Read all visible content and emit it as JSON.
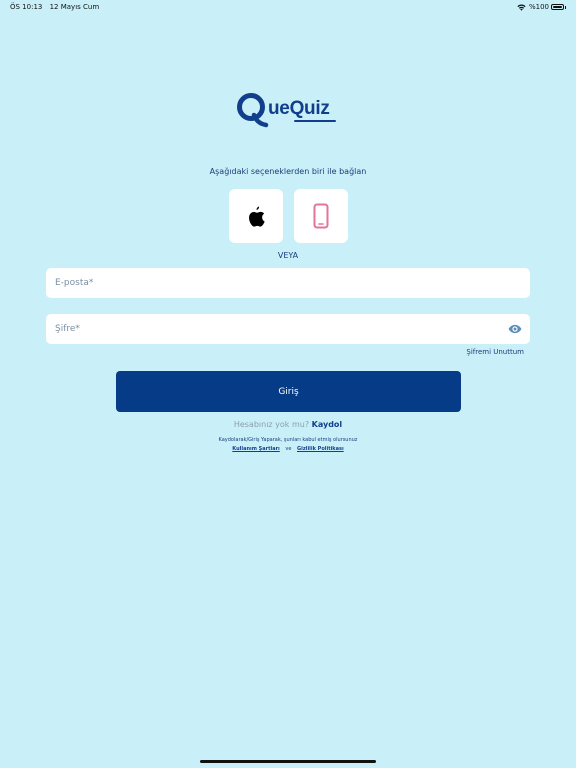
{
  "status_bar": {
    "time": "ÖS 10:13",
    "date": "12 Mayıs Cum",
    "battery": "%100"
  },
  "logo": {
    "text": "ueQuiz",
    "color": "#123f8c"
  },
  "connect": {
    "label": "Aşağıdaki seçeneklerden biri ile bağlan"
  },
  "social": {
    "apple_icon": "apple-icon",
    "phone_icon": "phone-icon",
    "phone_color": "#e0749a"
  },
  "or_label": "VEYA",
  "form": {
    "email_value": "",
    "email_placeholder": "E-posta*",
    "password_value": "",
    "password_placeholder": "Şifre*",
    "eye_icon": "eye-icon",
    "forgot_label": "Şifremi Unuttum",
    "login_label": "Giriş"
  },
  "signup": {
    "question": "Hesabınız yok mu?",
    "link": "Kaydol"
  },
  "terms": {
    "text": "Kaydolarak/Giriş Yaparak, şunları kabul etmiş olursunuz",
    "terms_link": "Kullanım Şartları",
    "separator": "ve",
    "privacy_link": "Gizlilik Politikası"
  },
  "colors": {
    "background": "#c9f0f8",
    "primary": "#063b87"
  }
}
